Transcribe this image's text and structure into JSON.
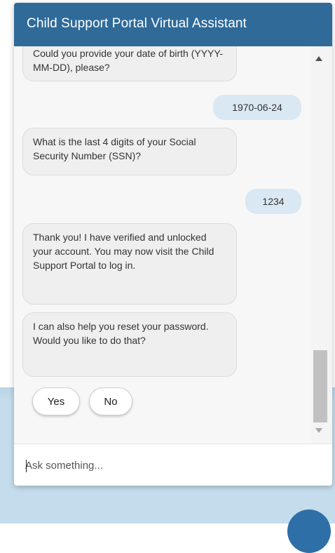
{
  "header": {
    "title": "Child Support Portal Virtual Assistant"
  },
  "messages": [
    {
      "sender": "bot",
      "text": "Could you provide your date of birth (YYYY-MM-DD), please?"
    },
    {
      "sender": "user",
      "text": "1970-06-24"
    },
    {
      "sender": "bot",
      "text": "What is the last 4 digits of your Social Security Number (SSN)?"
    },
    {
      "sender": "user",
      "text": "1234"
    },
    {
      "sender": "bot",
      "text": "Thank you! I have verified and unlocked your account. You may now visit the Child Support Portal to log in."
    },
    {
      "sender": "bot",
      "text": "I can also help you reset your password. Would you like to do that?"
    }
  ],
  "quick_replies": {
    "yes_label": "Yes",
    "no_label": "No"
  },
  "input": {
    "placeholder": "Ask something...",
    "value": ""
  },
  "colors": {
    "header_bg": "#2f6a99",
    "user_bubble_bg": "#dae8f3",
    "bot_bubble_bg": "#efefef",
    "page_band": "#c5dcec"
  },
  "icons": {
    "scroll_up": "triangle-up-icon",
    "scroll_down": "triangle-down-icon"
  }
}
